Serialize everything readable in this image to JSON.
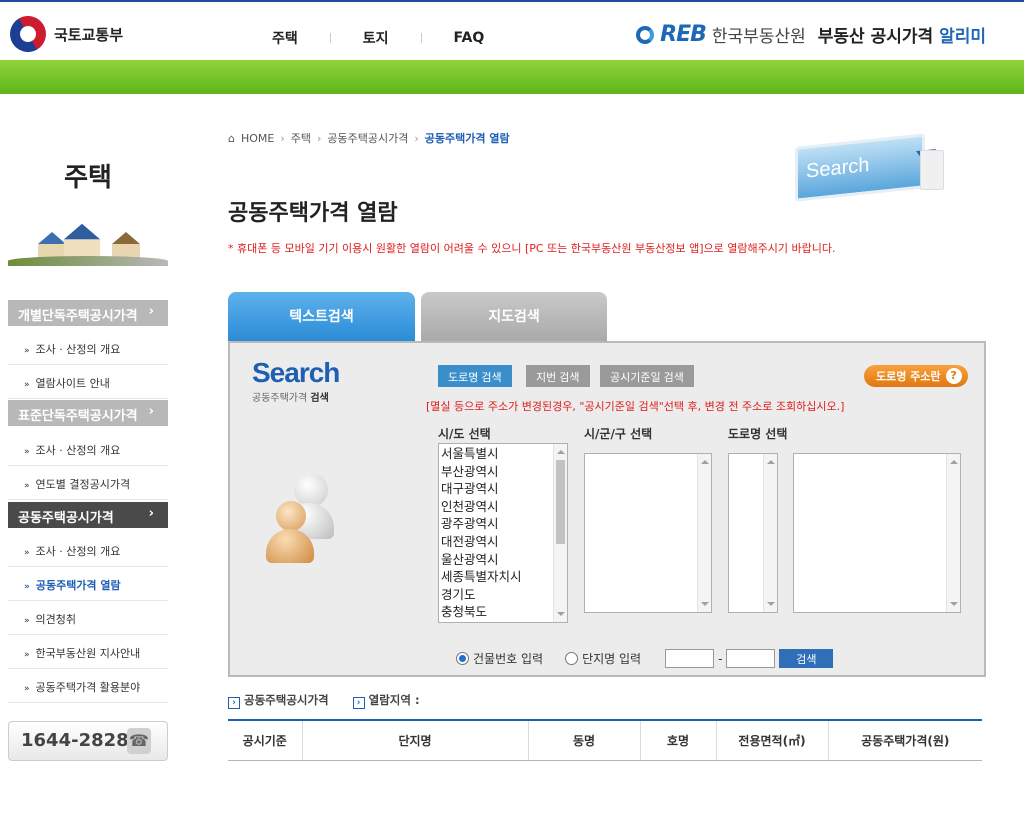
{
  "header": {
    "gov_name": "국토교통부",
    "nav": [
      "주택",
      "토지",
      "FAQ"
    ],
    "reb_logo": "REB",
    "reb_name": "한국부동산원",
    "service_title": "부동산 공시가격",
    "service_title_accent": "알리미"
  },
  "sidebar": {
    "title": "주택",
    "groups": [
      {
        "label": "개별단독주택공시가격",
        "arrow": "›",
        "active": false,
        "items": [
          "조사 · 산정의 개요",
          "열람사이트 안내"
        ]
      },
      {
        "label": "표준단독주택공시가격",
        "arrow": "›",
        "active": false,
        "items": [
          "조사 · 산정의 개요",
          "연도별 결정공시가격"
        ]
      },
      {
        "label": "공동주택공시가격",
        "arrow": "›",
        "active": true,
        "items": [
          "조사 · 산정의 개요",
          "공동주택가격 열람",
          "의견청취",
          "한국부동산원 지사안내",
          "공동주택가격 활용분야"
        ]
      }
    ],
    "current_item": "공동주택가격 열람",
    "phone": "1644-2828",
    "phone_icon": "telephone-icon"
  },
  "breadcrumb": [
    "HOME",
    "주택",
    "공동주택공시가격",
    "공동주택가격 열람"
  ],
  "visual_text": "Search",
  "page_title": "공동주택가격 열람",
  "notice": "* 휴대폰 등 모바일 기기 이용시 원활한 열람이 어려울 수 있으니 [PC 또는 한국부동산원 부동산정보 앱]으로 열람해주시기 바랍니다.",
  "tabs": {
    "text_search": "텍스트검색",
    "map_search": "지도검색"
  },
  "search": {
    "logo_word": "Search",
    "logo_sub_prefix": "공동주택가격",
    "logo_sub_bold": "검색",
    "btn_road": "도로명 검색",
    "btn_jibun": "지번 검색",
    "btn_date": "공시기준일 검색",
    "btn_road_addr": "도로명 주소란",
    "help_mark": "?",
    "notice": "[멸실 등으로 주소가 변경된경우, \"공시기준일 검색\"선택 후, 변경 전 주소로 조회하십시오.]",
    "label_sido": "시/도 선택",
    "label_sigungu": "시/군/구 선택",
    "label_road": "도로명 선택",
    "sido_options": [
      "서울특별시",
      "부산광역시",
      "대구광역시",
      "인천광역시",
      "광주광역시",
      "대전광역시",
      "울산광역시",
      "세종특별자치시",
      "경기도",
      "충청북도"
    ],
    "radio_building": "건물번호 입력",
    "radio_complex": "단지명 입력",
    "radio_selected": "건물번호 입력",
    "dash": "-",
    "btn_go": "검색"
  },
  "subtabs": {
    "first": "공동주택공시가격",
    "second": "열람지역 :"
  },
  "table": {
    "headers": [
      "공시기준",
      "단지명",
      "동명",
      "호명",
      "전용면적(㎡)",
      "공동주택가격(원)"
    ]
  },
  "colors": {
    "brand_blue": "#1e5fb3",
    "green_bar": "#6cbf22",
    "notice_red": "#e01b1b",
    "tab_active": "#2a8bd6"
  }
}
